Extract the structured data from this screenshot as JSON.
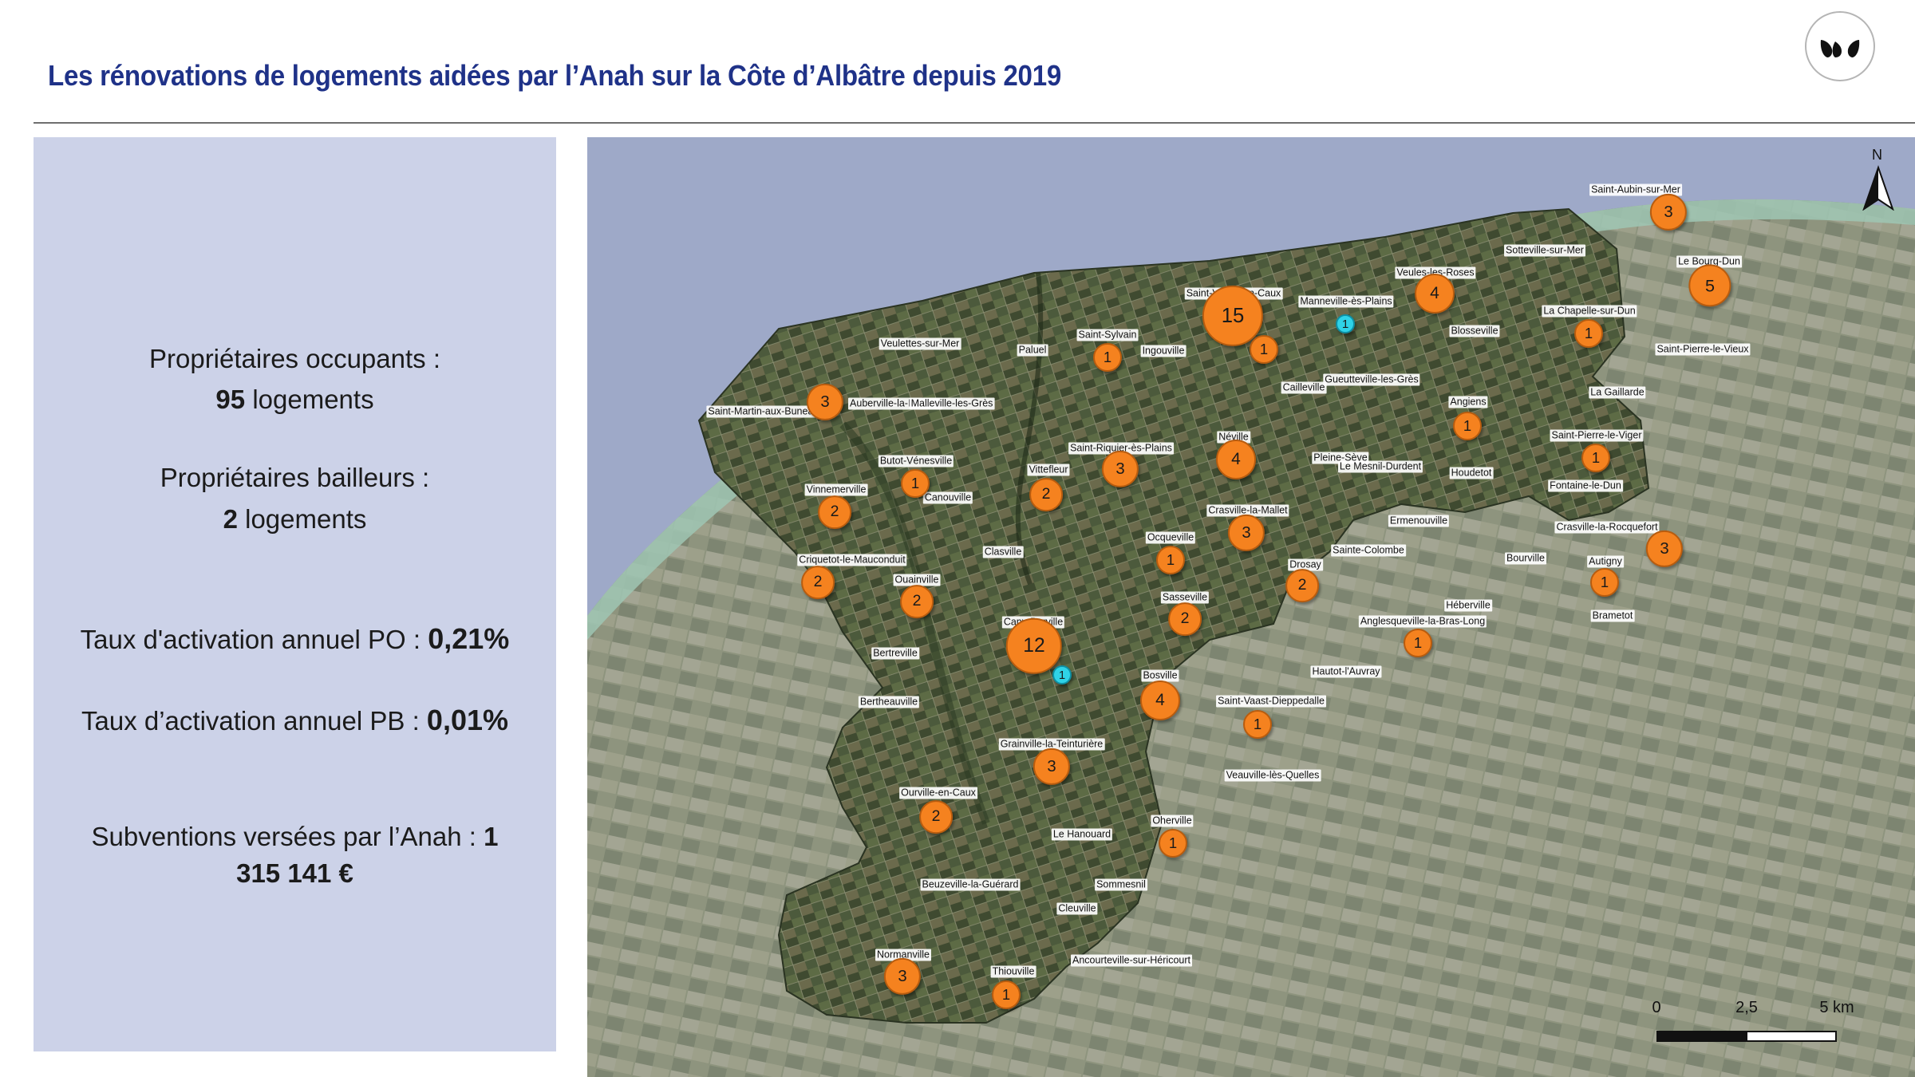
{
  "title": "Les rénovations de logements aidées par l’Anah sur la Côte d’Albâtre depuis 2019",
  "logo": {
    "icon": "leaf-logo-icon"
  },
  "panel": {
    "po_label": "Propriétaires occupants :",
    "po_value": "95",
    "po_unit": "logements",
    "pb_label": "Propriétaires bailleurs :",
    "pb_value": "2",
    "pb_unit": "logements",
    "rate_po_label": "Taux d'activation annuel PO :",
    "rate_po_value": "0,21%",
    "rate_pb_label": "Taux d’activation annuel PB :",
    "rate_pb_value": "0,01%",
    "subsidy_label": "Subventions versées par l’Anah :",
    "subsidy_value_a": "1",
    "subsidy_value_b": "315 141 €"
  },
  "map": {
    "north_label": "N",
    "scale": {
      "labels": [
        "0",
        "2,5",
        "5 km"
      ]
    },
    "colors": {
      "po": "#f5821f",
      "pb": "#2fd3e8",
      "sea": "#9ea9c8"
    },
    "places": [
      "Saint-Aubin-sur-Mer",
      "Sotteville-sur-Mer",
      "Le Bourg-Dun",
      "Veules-les-Roses",
      "Saint-Valery-en-Caux",
      "Manneville-ès-Plains",
      "La Chapelle-sur-Dun",
      "Blosseville",
      "Saint-Pierre-le-Vieux",
      "Saint-Sylvain",
      "Ingouville",
      "Veulettes-sur-Mer",
      "Paluel",
      "Gueutteville-les-Grès",
      "Cailleville",
      "La Gaillarde",
      "Angiens",
      "Auberville-la-Manuel",
      "Malleville-les-Grès",
      "Saint-Martin-aux-Buneaux",
      "Néville",
      "Saint-Pierre-le-Viger",
      "Saint-Riquier-ès-Plains",
      "Butot-Vénesville",
      "Pleine-Sève",
      "Le Mesnil-Durdent",
      "Houdetot",
      "Vittefleur",
      "Fontaine-le-Dun",
      "Canouville",
      "Vinnemerville",
      "Crasville-la-Mallet",
      "Ermenouville",
      "Crasville-la-Rocquefort",
      "Ocqueville",
      "Clasville",
      "Sainte-Colombe",
      "Bourville",
      "Criquetot-le-Mauconduit",
      "Drosay",
      "Autigny",
      "Ouainville",
      "Sasseville",
      "Héberville",
      "Anglesqueville-la-Bras-Long",
      "Brametot",
      "Cany-Barville",
      "Bertreville",
      "Hautot-l'Auvray",
      "Bosville",
      "Bertheauville",
      "Saint-Vaast-Dieppedalle",
      "Grainville-la-Teinturière",
      "Veauville-lès-Quelles",
      "Ourville-en-Caux",
      "Oherville",
      "Le Hanouard",
      "Beuzeville-la-Guérard",
      "Sommesnil",
      "Cleuville",
      "Normanville",
      "Ancourteville-sur-Héricourt",
      "Thiouville"
    ],
    "bubbles": [
      "3",
      "5",
      "4",
      "15",
      "1",
      "1",
      "1",
      "1",
      "3",
      "1",
      "3",
      "4",
      "1",
      "1",
      "2",
      "2",
      "1",
      "3",
      "3",
      "1",
      "2",
      "2",
      "2",
      "1",
      "12",
      "1",
      "4",
      "2",
      "1",
      "3",
      "2",
      "1",
      "3",
      "1"
    ]
  }
}
